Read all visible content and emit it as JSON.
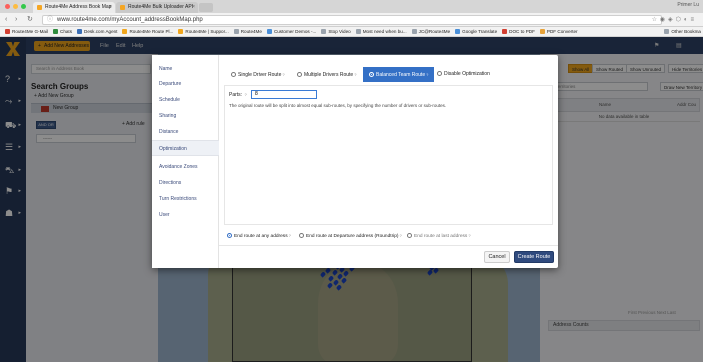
{
  "browser": {
    "tabs": [
      {
        "label": "Route4Me Address Book Map"
      },
      {
        "label": "Route4Me Bulk Uploader API"
      }
    ],
    "profile": "Primer Lu",
    "url": "www.route4me.com/myAccount_addressBookMap.php",
    "bookmarks": [
      {
        "label": "Route4Me G-Mail",
        "color": "#d23f31"
      },
      {
        "label": "Chats",
        "color": "#2f8c3e"
      },
      {
        "label": "Desk.com Agent",
        "color": "#3b6fb6"
      },
      {
        "label": "Route4Me Route Pl...",
        "color": "#f0a61d"
      },
      {
        "label": "Route4Me | Suppor...",
        "color": "#f0a61d"
      },
      {
        "label": "Route4Me",
        "color": "#9aa3ad"
      },
      {
        "label": "Customer Demos -...",
        "color": "#4a8fd8"
      },
      {
        "label": "Stop Video",
        "color": "#9aa3ad"
      },
      {
        "label": "Most need when bu...",
        "color": "#9aa3ad"
      },
      {
        "label": "JC@Route4Me",
        "color": "#9aa3ad"
      },
      {
        "label": "Google Translate",
        "color": "#4a8fd8"
      },
      {
        "label": "DOC to PDF",
        "color": "#d23f31"
      },
      {
        "label": "PDF Converter",
        "color": "#e8a33a"
      }
    ],
    "other_bookmarks": "Other Bookma"
  },
  "topstrip": {
    "add_label": "Add New Addresses",
    "menus": [
      "File",
      "Edit",
      "Help"
    ]
  },
  "left": {
    "search_placeholder": "Search in Address Book",
    "title": "Search Groups",
    "add_group": "+ Add New Group",
    "group_name": "New Group",
    "andor": "AND  OR",
    "add_rule": "+ Add rule",
    "rule_value": "------"
  },
  "right": {
    "buttons": [
      "Show All",
      "Show Routed",
      "Show Unrouted",
      "Hide Territories"
    ],
    "search_placeholder": "n Territories",
    "draw_btn": "Draw New Territory",
    "col_name": "Name",
    "col_end": "Addr Cou",
    "empty": "No data available in table",
    "pager": "First   Previous   Next   Last",
    "counts_title": "Address Counts"
  },
  "modal": {
    "side": [
      "Name",
      "Departure",
      "Schedule",
      "Sharing",
      "Distance",
      "Optimization",
      "Avoidance Zones",
      "Directions",
      "Turn Restrictions",
      "User"
    ],
    "active_side": 5,
    "route_types": [
      {
        "label": "Single Driver Route",
        "help": "?"
      },
      {
        "label": "Multiple Drivers Route",
        "help": "?"
      },
      {
        "label": "Balanced Team Route",
        "help": "?"
      },
      {
        "label": "Disable Optimization",
        "help": ""
      }
    ],
    "selected_type": 2,
    "parts_label": "Parts:",
    "parts_help": "?",
    "parts_value": "8",
    "description": "The original route will be split into almost equal sub-routes, by specifying the number of drivers or sub-routes.",
    "end_options": [
      {
        "label": "End route at any address",
        "help": "?"
      },
      {
        "label": "End route at Departure address (Roundtrip)",
        "help": "?"
      },
      {
        "label": "End route at last address",
        "help": "?"
      }
    ],
    "selected_end": 0,
    "cancel": "Cancel",
    "create": "Create Route"
  }
}
